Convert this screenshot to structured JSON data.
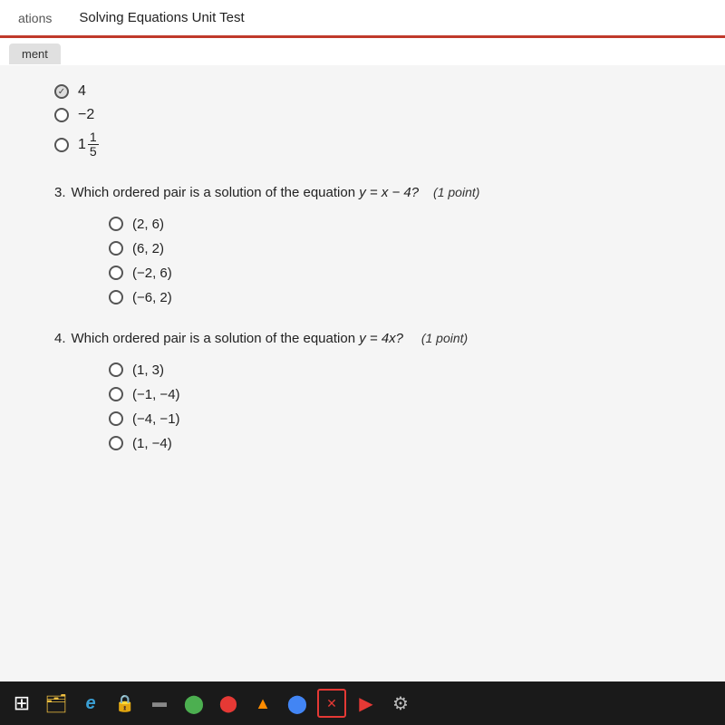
{
  "titleBar": {
    "leftLabel": "ations",
    "title": "Solving Equations Unit Test"
  },
  "topTab": {
    "label": "ment"
  },
  "prevAnswers": [
    {
      "id": "prev1",
      "text": "4",
      "selected": true,
      "type": "checkmark"
    },
    {
      "id": "prev2",
      "text": "−2",
      "selected": false
    },
    {
      "id": "prev3",
      "text": "fraction",
      "numerator": "1",
      "denominator": "5",
      "selected": false
    }
  ],
  "questions": [
    {
      "number": "3.",
      "questionText": "Which ordered pair is a solution of the equation ",
      "equation": "y = x − 4?",
      "pointLabel": "(1 point)",
      "options": [
        {
          "id": "q3a",
          "text": "(2, 6)"
        },
        {
          "id": "q3b",
          "text": "(6, 2)"
        },
        {
          "id": "q3c",
          "text": "(−2, 6)"
        },
        {
          "id": "q3d",
          "text": "(−6, 2)"
        }
      ]
    },
    {
      "number": "4.",
      "questionText": "Which ordered pair is a solution of the equation ",
      "equation": "y = 4x?",
      "pointLabel": "(1 point)",
      "options": [
        {
          "id": "q4a",
          "text": "(1, 3)"
        },
        {
          "id": "q4b",
          "text": "(−1, −4)"
        },
        {
          "id": "q4c",
          "text": "(−4, −1)"
        },
        {
          "id": "q4d",
          "text": "(1, −4)"
        }
      ]
    }
  ],
  "taskbar": {
    "icons": [
      {
        "name": "windows",
        "symbol": "⊞"
      },
      {
        "name": "folder",
        "symbol": "📁"
      },
      {
        "name": "edge",
        "symbol": "e"
      },
      {
        "name": "lock",
        "symbol": "🔒"
      },
      {
        "name": "terminal",
        "symbol": "▬"
      },
      {
        "name": "xbox",
        "symbol": "⬤"
      },
      {
        "name": "red-dot",
        "symbol": "⬤"
      },
      {
        "name": "triangle",
        "symbol": "▲"
      },
      {
        "name": "chrome",
        "symbol": "⬤"
      },
      {
        "name": "close-x",
        "symbol": "✕"
      },
      {
        "name": "youtube",
        "symbol": "▶"
      },
      {
        "name": "gear",
        "symbol": "⚙"
      }
    ]
  }
}
